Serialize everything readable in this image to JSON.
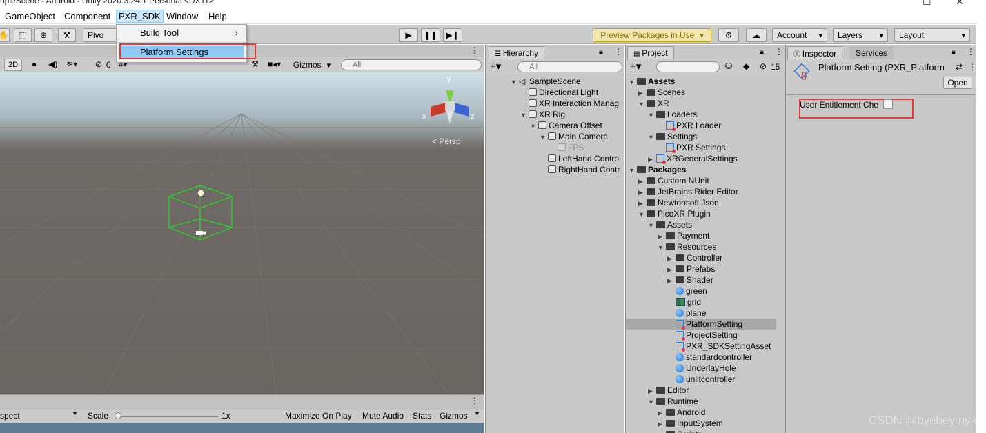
{
  "window": {
    "title": "npleScene - Android - Unity 2020.3.24f1 Personal <DX11>",
    "minimize": "—",
    "maximize": "☐",
    "close": "✕"
  },
  "menubar": [
    "GameObject",
    "Component",
    "PXR_SDK",
    "Window",
    "Help"
  ],
  "pxr_menu": {
    "items": [
      "Build Tool",
      "Platform Settings"
    ],
    "submenu_arrow": "›"
  },
  "toolbar": {
    "pivot": "Pivo",
    "preview_packages": "Preview Packages in Use",
    "account": "Account",
    "layers": "Layers",
    "layout": "Layout"
  },
  "scene": {
    "mode_2d": "2D",
    "hidden_count": "0",
    "gizmos": "Gizmos",
    "search_placeholder": "All",
    "gizmo_y": "y",
    "gizmo_x": "x",
    "gizmo_z": "z",
    "persp": "< Persp"
  },
  "game_bar": {
    "aspect": "spect",
    "scale_label": "Scale",
    "scale_value": "1x",
    "maximize": "Maximize On Play",
    "mute": "Mute Audio",
    "stats": "Stats",
    "gizmos": "Gizmos"
  },
  "hierarchy": {
    "tab": "Hierarchy",
    "search_placeholder": "All",
    "items": [
      {
        "label": "SampleScene",
        "depth": 0,
        "arrow": "▼",
        "icon": "unity-scene"
      },
      {
        "label": "Directional Light",
        "depth": 1,
        "arrow": "",
        "icon": "cube"
      },
      {
        "label": "XR Interaction Manag",
        "depth": 1,
        "arrow": "",
        "icon": "cube"
      },
      {
        "label": "XR Rig",
        "depth": 1,
        "arrow": "▼",
        "icon": "cube"
      },
      {
        "label": "Camera Offset",
        "depth": 2,
        "arrow": "▼",
        "icon": "cube"
      },
      {
        "label": "Main Camera",
        "depth": 3,
        "arrow": "▼",
        "icon": "cube"
      },
      {
        "label": "FPS",
        "depth": 4,
        "arrow": "",
        "icon": "cube-disabled"
      },
      {
        "label": "LeftHand Contro",
        "depth": 3,
        "arrow": "",
        "icon": "cube"
      },
      {
        "label": "RightHand Contr",
        "depth": 3,
        "arrow": "",
        "icon": "cube"
      }
    ]
  },
  "project": {
    "tab": "Project",
    "hidden_count": "15",
    "items": [
      {
        "label": "Assets",
        "depth": 0,
        "arrow": "▼",
        "icon": "folder",
        "bold": true
      },
      {
        "label": "Scenes",
        "depth": 1,
        "arrow": "▶",
        "icon": "folder"
      },
      {
        "label": "XR",
        "depth": 1,
        "arrow": "▼",
        "icon": "folder"
      },
      {
        "label": "Loaders",
        "depth": 2,
        "arrow": "▼",
        "icon": "folder"
      },
      {
        "label": "PXR Loader",
        "depth": 3,
        "arrow": "",
        "icon": "scriptable-object"
      },
      {
        "label": "Settings",
        "depth": 2,
        "arrow": "▼",
        "icon": "folder"
      },
      {
        "label": "PXR Settings",
        "depth": 3,
        "arrow": "",
        "icon": "scriptable-object"
      },
      {
        "label": "XRGeneralSettings",
        "depth": 2,
        "arrow": "▶",
        "icon": "scriptable-object"
      },
      {
        "label": "Packages",
        "depth": 0,
        "arrow": "▼",
        "icon": "folder",
        "bold": true
      },
      {
        "label": "Custom NUnit",
        "depth": 1,
        "arrow": "▶",
        "icon": "folder"
      },
      {
        "label": "JetBrains Rider Editor",
        "depth": 1,
        "arrow": "▶",
        "icon": "folder"
      },
      {
        "label": "Newtonsoft Json",
        "depth": 1,
        "arrow": "▶",
        "icon": "folder"
      },
      {
        "label": "PicoXR Plugin",
        "depth": 1,
        "arrow": "▼",
        "icon": "folder"
      },
      {
        "label": "Assets",
        "depth": 2,
        "arrow": "▼",
        "icon": "folder"
      },
      {
        "label": "Payment",
        "depth": 3,
        "arrow": "▶",
        "icon": "folder"
      },
      {
        "label": "Resources",
        "depth": 3,
        "arrow": "▼",
        "icon": "folder"
      },
      {
        "label": "Controller",
        "depth": 4,
        "arrow": "▶",
        "icon": "folder"
      },
      {
        "label": "Prefabs",
        "depth": 4,
        "arrow": "▶",
        "icon": "folder"
      },
      {
        "label": "Shader",
        "depth": 4,
        "arrow": "▶",
        "icon": "folder"
      },
      {
        "label": "green",
        "depth": 4,
        "arrow": "",
        "icon": "material"
      },
      {
        "label": "grid",
        "depth": 4,
        "arrow": "",
        "icon": "texture"
      },
      {
        "label": "plane",
        "depth": 4,
        "arrow": "",
        "icon": "material"
      },
      {
        "label": "PlatformSetting",
        "depth": 4,
        "arrow": "",
        "icon": "scriptable-object",
        "selected": true
      },
      {
        "label": "ProjectSetting",
        "depth": 4,
        "arrow": "",
        "icon": "scriptable-object"
      },
      {
        "label": "PXR_SDKSettingAsset",
        "depth": 4,
        "arrow": "",
        "icon": "scriptable-object"
      },
      {
        "label": "standardcontroller",
        "depth": 4,
        "arrow": "",
        "icon": "material"
      },
      {
        "label": "UnderlayHole",
        "depth": 4,
        "arrow": "",
        "icon": "material"
      },
      {
        "label": "unlitcontroller",
        "depth": 4,
        "arrow": "",
        "icon": "material"
      },
      {
        "label": "Editor",
        "depth": 2,
        "arrow": "▶",
        "icon": "folder"
      },
      {
        "label": "Runtime",
        "depth": 2,
        "arrow": "▼",
        "icon": "folder"
      },
      {
        "label": "Android",
        "depth": 3,
        "arrow": "▶",
        "icon": "folder"
      },
      {
        "label": "InputSystem",
        "depth": 3,
        "arrow": "▶",
        "icon": "folder"
      },
      {
        "label": "Scripts",
        "depth": 3,
        "arrow": "▶",
        "icon": "folder"
      }
    ]
  },
  "inspector": {
    "tab": "Inspector",
    "services_tab": "Services",
    "title": "Platform Setting (PXR_Platform",
    "open_button": "Open",
    "field_label": "User Entitlement Che",
    "field_checked": false
  },
  "watermark": "CSDN @byebeymyk",
  "colors": {
    "highlight_red": "#e03a3a",
    "menu_highlight": "#91c9f7",
    "gizmo_green": "#33ff33"
  }
}
